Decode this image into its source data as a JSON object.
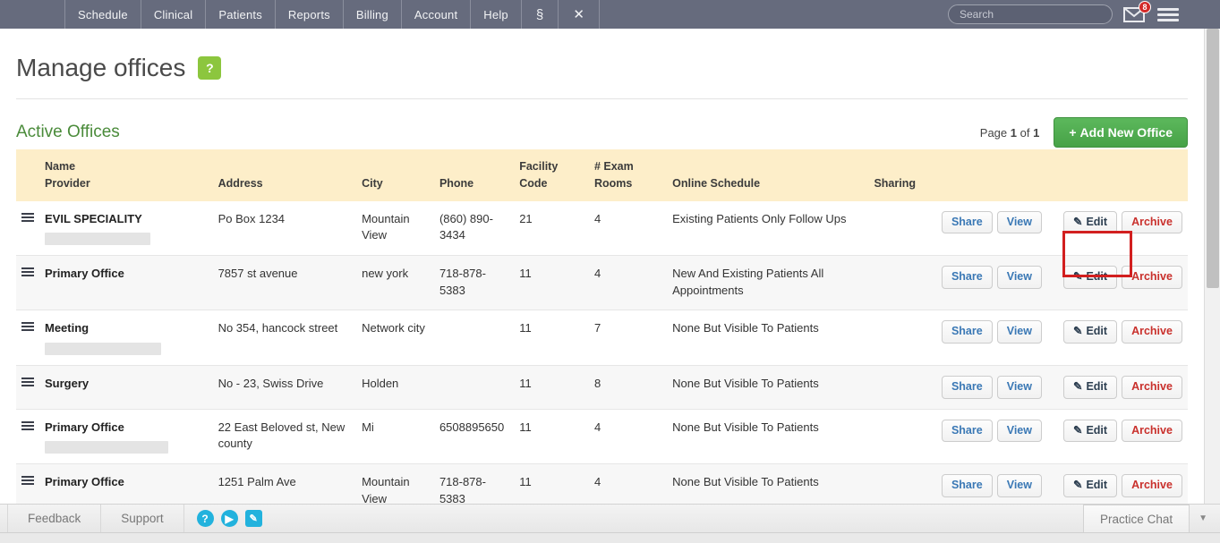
{
  "topnav": {
    "items": [
      {
        "label": "Schedule",
        "name": "nav-schedule"
      },
      {
        "label": "Clinical",
        "name": "nav-clinical"
      },
      {
        "label": "Patients",
        "name": "nav-patients"
      },
      {
        "label": "Reports",
        "name": "nav-reports"
      },
      {
        "label": "Billing",
        "name": "nav-billing"
      },
      {
        "label": "Account",
        "name": "nav-account"
      },
      {
        "label": "Help",
        "name": "nav-help"
      }
    ],
    "icon_items": [
      {
        "label": "§",
        "name": "nav-dollar-icon"
      },
      {
        "label": "✕",
        "name": "nav-x-icon"
      }
    ],
    "search_placeholder": "Search",
    "search_value": "",
    "mail_badge": "8"
  },
  "header": {
    "title": "Manage offices",
    "help_label": "?"
  },
  "section": {
    "title": "Active Offices",
    "page_prefix": "Page",
    "page_current": "1",
    "page_middle": "of",
    "page_total": "1",
    "add_button": "Add New Office",
    "add_plus": "+"
  },
  "table": {
    "columns": [
      {
        "line1": "",
        "line2": "",
        "name": "col-grip"
      },
      {
        "line1": "Name",
        "line2": "Provider",
        "name": "col-name"
      },
      {
        "line1": "",
        "line2": "Address",
        "name": "col-address"
      },
      {
        "line1": "",
        "line2": "City",
        "name": "col-city"
      },
      {
        "line1": "",
        "line2": "Phone",
        "name": "col-phone"
      },
      {
        "line1": "Facility",
        "line2": "Code",
        "name": "col-facility-code"
      },
      {
        "line1": "# Exam",
        "line2": "Rooms",
        "name": "col-exam-rooms"
      },
      {
        "line1": "",
        "line2": "Online Schedule",
        "name": "col-online-schedule"
      },
      {
        "line1": "",
        "line2": "Sharing",
        "name": "col-sharing"
      },
      {
        "line1": "",
        "line2": "",
        "name": "col-actions"
      }
    ],
    "rows": [
      {
        "name": "EVIL SPECIALITY",
        "redacted": true,
        "address": "Po Box 1234",
        "city": "Mountain View",
        "phone": "(860) 890-3434",
        "facility_code": "21",
        "exam_rooms": "4",
        "online_schedule": "Existing Patients Only Follow Ups",
        "share": "Share",
        "view": "View",
        "edit": "Edit",
        "archive": "Archive"
      },
      {
        "name": "Primary Office",
        "redacted": false,
        "address": "7857 st avenue",
        "city": "new york",
        "phone": "718-878-5383",
        "facility_code": "11",
        "exam_rooms": "4",
        "online_schedule": "New And Existing Patients All Appointments",
        "share": "Share",
        "view": "View",
        "edit": "Edit",
        "archive": "Archive"
      },
      {
        "name": "Meeting",
        "redacted": true,
        "address": "No 354, hancock street",
        "city": "Network city",
        "phone": "",
        "facility_code": "11",
        "exam_rooms": "7",
        "online_schedule": "None But Visible To Patients",
        "share": "Share",
        "view": "View",
        "edit": "Edit",
        "archive": "Archive"
      },
      {
        "name": "Surgery",
        "redacted": false,
        "address": "No - 23, Swiss Drive",
        "city": "Holden",
        "phone": "",
        "facility_code": "11",
        "exam_rooms": "8",
        "online_schedule": "None But Visible To Patients",
        "share": "Share",
        "view": "View",
        "edit": "Edit",
        "archive": "Archive"
      },
      {
        "name": "Primary Office",
        "redacted": true,
        "address": "22 East Beloved st, New county",
        "city": "Mi",
        "phone": "6508895650",
        "facility_code": "11",
        "exam_rooms": "4",
        "online_schedule": "None But Visible To Patients",
        "share": "Share",
        "view": "View",
        "edit": "Edit",
        "archive": "Archive"
      },
      {
        "name": "Primary Office",
        "redacted": false,
        "address": "1251 Palm Ave",
        "city": "Mountain View",
        "phone": "718-878-5383",
        "facility_code": "11",
        "exam_rooms": "4",
        "online_schedule": "None But Visible To Patients",
        "share": "Share",
        "view": "View",
        "edit": "Edit",
        "archive": "Archive"
      }
    ]
  },
  "footer": {
    "feedback": "Feedback",
    "support": "Support",
    "icons": [
      {
        "glyph": "?",
        "name": "help-circle-icon"
      },
      {
        "glyph": "▶",
        "name": "play-circle-icon"
      },
      {
        "glyph": "✎",
        "name": "pencil-square-icon"
      }
    ],
    "chat": "Practice Chat",
    "chat_caret": "▼"
  },
  "colors": {
    "nav_bg": "#666b7d",
    "accent_green": "#4a8b3a",
    "table_header": "#fdeec9",
    "highlight": "#d21f1f",
    "badge_red": "#d32a28"
  }
}
